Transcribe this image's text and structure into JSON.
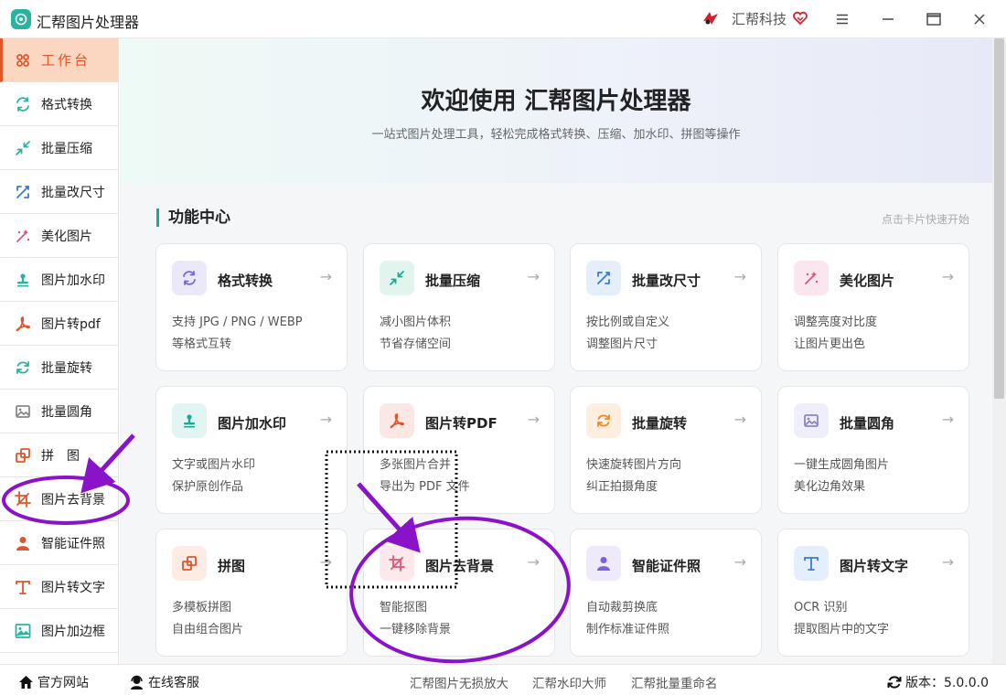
{
  "window": {
    "title": "汇帮图片处理器",
    "brand": "汇帮科技"
  },
  "sidebar": {
    "items": [
      {
        "label": "工作台",
        "icon": "grid-icon",
        "color": "#e0552a"
      },
      {
        "label": "格式转换",
        "icon": "convert-icon",
        "color": "#2bb3a0"
      },
      {
        "label": "批量压缩",
        "icon": "compress-icon",
        "color": "#2bb3a0"
      },
      {
        "label": "批量改尺寸",
        "icon": "resize-icon",
        "color": "#3a7bd5"
      },
      {
        "label": "美化图片",
        "icon": "beautify-icon",
        "color": "#e0557a"
      },
      {
        "label": "图片加水印",
        "icon": "watermark-icon",
        "color": "#2bb3a0"
      },
      {
        "label": "图片转pdf",
        "icon": "pdf-icon",
        "color": "#e0552a"
      },
      {
        "label": "批量旋转",
        "icon": "rotate-icon",
        "color": "#2bb3a0"
      },
      {
        "label": "批量圆角",
        "icon": "image-icon",
        "color": "#888888"
      },
      {
        "label": "拼　图",
        "icon": "puzzle-icon",
        "color": "#e0552a"
      },
      {
        "label": "图片去背景",
        "icon": "crop-icon",
        "color": "#e0552a"
      },
      {
        "label": "智能证件照",
        "icon": "person-icon",
        "color": "#e0552a"
      },
      {
        "label": "图片转文字",
        "icon": "text-icon",
        "color": "#e0552a"
      },
      {
        "label": "图片加边框",
        "icon": "frame-icon",
        "color": "#2bb3a0"
      }
    ]
  },
  "hero": {
    "title": "欢迎使用 汇帮图片处理器",
    "subtitle": "一站式图片处理工具，轻松完成格式转换、压缩、加水印、拼图等操作"
  },
  "section": {
    "title": "功能中心",
    "hint": "点击卡片快速开始"
  },
  "cards": [
    {
      "title": "格式转换",
      "d1": "支持 JPG / PNG / WEBP",
      "d2": "等格式互转",
      "icon": "convert-icon",
      "bg": "#ece8fb",
      "fg": "#7b61e0"
    },
    {
      "title": "批量压缩",
      "d1": "减小图片体积",
      "d2": "节省存储空间",
      "icon": "compress-icon",
      "bg": "#e1f5ee",
      "fg": "#1fa88e"
    },
    {
      "title": "批量改尺寸",
      "d1": "按比例或自定义",
      "d2": "调整图片尺寸",
      "icon": "resize-icon",
      "bg": "#e5eefb",
      "fg": "#3a7bd5"
    },
    {
      "title": "美化图片",
      "d1": "调整亮度对比度",
      "d2": "让图片更出色",
      "icon": "beautify-icon",
      "bg": "#fbe5ee",
      "fg": "#e0557a"
    },
    {
      "title": "图片加水印",
      "d1": "文字或图片水印",
      "d2": "保护原创作品",
      "icon": "watermark-icon",
      "bg": "#e1f5f3",
      "fg": "#1fa88e"
    },
    {
      "title": "图片转PDF",
      "d1": "多张图片合并",
      "d2": "导出为 PDF 文件",
      "icon": "pdf-icon",
      "bg": "#fbe8e4",
      "fg": "#e0552a"
    },
    {
      "title": "批量旋转",
      "d1": "快速旋转图片方向",
      "d2": "纠正拍摄角度",
      "icon": "rotate-icon",
      "bg": "#fdeee0",
      "fg": "#f08a24"
    },
    {
      "title": "批量圆角",
      "d1": "一键生成圆角图片",
      "d2": "美化边角效果",
      "icon": "image-icon",
      "bg": "#efeefb",
      "fg": "#8a86c9"
    },
    {
      "title": "拼图",
      "d1": "多模板拼图",
      "d2": "自由组合图片",
      "icon": "puzzle-icon",
      "bg": "#fdece4",
      "fg": "#e0552a"
    },
    {
      "title": "图片去背景",
      "d1": "智能抠图",
      "d2": "一键移除背景",
      "icon": "crop-icon",
      "bg": "#fde8ec",
      "fg": "#e0557a"
    },
    {
      "title": "智能证件照",
      "d1": "自动裁剪换底",
      "d2": "制作标准证件照",
      "icon": "person-icon",
      "bg": "#eeeafb",
      "fg": "#7b61e0"
    },
    {
      "title": "图片转文字",
      "d1": "OCR 识别",
      "d2": "提取图片中的文字",
      "icon": "text-icon",
      "bg": "#e5effb",
      "fg": "#3a7bd5"
    }
  ],
  "footer": {
    "website": "官方网站",
    "support": "在线客服",
    "links": [
      "汇帮图片无损放大",
      "汇帮水印大师",
      "汇帮批量重命名"
    ],
    "version": "版本：5.0.0.0"
  }
}
